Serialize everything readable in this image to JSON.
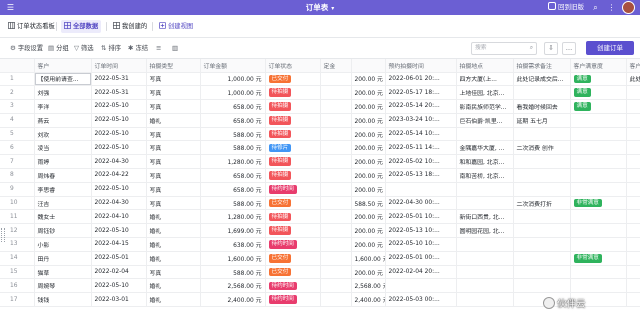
{
  "header": {
    "title": "订单表",
    "home_label": "回到旧版",
    "accent": "#6b5fd3"
  },
  "views": [
    {
      "label": "订单状态看板"
    },
    {
      "label": "全部数据"
    },
    {
      "label": "我创建的"
    },
    {
      "label": "创建视图"
    }
  ],
  "toolbar": {
    "field_settings": "字段设置",
    "group": "分组",
    "filter": "筛选",
    "sort": "排序",
    "freeze": "冻结",
    "search_placeholder": "搜索",
    "create_button": "创建订单"
  },
  "columns": [
    "",
    "客户",
    "订单时间",
    "拍摄类型",
    "订单金额",
    "订单状态",
    "定金",
    "",
    "预约拍摄时间",
    "拍摄地点",
    "拍摄需求备注",
    "客户满意度",
    "客户评价内容"
  ],
  "rows": [
    {
      "n": "1",
      "customer": "【使用前请查...",
      "date": "2022-05-31",
      "type": "写真",
      "amount": "1,000.00 元",
      "status": "已交付",
      "status_kind": "paid",
      "deposit": "",
      "balance": "200.00 元",
      "appt": "2022-06-01 20:...",
      "place": "四方大厦(上...",
      "note": "此处记录成交后...",
      "sat": "满意",
      "sat_kind": "sat",
      "review": "此处记录客户..."
    },
    {
      "n": "2",
      "customer": "刘强",
      "date": "2022-05-31",
      "type": "写真",
      "amount": "1,000.00 元",
      "status": "待拍摄",
      "status_kind": "pending",
      "deposit": "",
      "balance": "200.00 元",
      "appt": "2022-05-17 18:...",
      "place": "上地佳园, 北京...",
      "note": "",
      "sat": "满意",
      "sat_kind": "sat",
      "review": ""
    },
    {
      "n": "3",
      "customer": "李洋",
      "date": "2022-05-10",
      "type": "写真",
      "amount": "658.00 元",
      "status": "待拍摄",
      "status_kind": "pending",
      "deposit": "",
      "balance": "200.00 元",
      "appt": "2022-05-14 20:...",
      "place": "影南民族师范学...",
      "note": "看我婚时候回去",
      "sat": "满意",
      "sat_kind": "sat",
      "review": ""
    },
    {
      "n": "4",
      "customer": "燕云",
      "date": "2022-05-10",
      "type": "婚礼",
      "amount": "658.00 元",
      "status": "待拍摄",
      "status_kind": "pending",
      "deposit": "",
      "balance": "200.00 元",
      "appt": "2023-03-24 10:...",
      "place": "巨石伯爵·凯里...",
      "note": "延期 五七月",
      "sat": "",
      "sat_kind": "",
      "review": ""
    },
    {
      "n": "5",
      "customer": "刘欢",
      "date": "2022-05-10",
      "type": "写真",
      "amount": "588.00 元",
      "status": "待拍摄",
      "status_kind": "pending",
      "deposit": "",
      "balance": "200.00 元",
      "appt": "2022-05-14 10:...",
      "place": "",
      "note": "",
      "sat": "",
      "sat_kind": "",
      "review": ""
    },
    {
      "n": "6",
      "customer": "凌当",
      "date": "2022-05-10",
      "type": "写真",
      "amount": "588.00 元",
      "status": "待修片",
      "status_kind": "film",
      "deposit": "",
      "balance": "200.00 元",
      "appt": "2022-05-11 14:...",
      "place": "金隅嘉华大厦, ...",
      "note": "二次消费 创作",
      "sat": "",
      "sat_kind": "",
      "review": ""
    },
    {
      "n": "7",
      "customer": "雨婷",
      "date": "2022-04-30",
      "type": "写真",
      "amount": "1,280.00 元",
      "status": "待拍摄",
      "status_kind": "pending",
      "deposit": "",
      "balance": "200.00 元",
      "appt": "2022-05-02 10:...",
      "place": "和和嘉园, 北京...",
      "note": "",
      "sat": "",
      "sat_kind": "",
      "review": ""
    },
    {
      "n": "8",
      "customer": "周炜春",
      "date": "2022-04-22",
      "type": "写真",
      "amount": "658.00 元",
      "status": "待拍摄",
      "status_kind": "pending",
      "deposit": "",
      "balance": "200.00 元",
      "appt": "2022-05-13 18:...",
      "place": "南和苦桥, 北京...",
      "note": "",
      "sat": "",
      "sat_kind": "",
      "review": ""
    },
    {
      "n": "9",
      "customer": "李思睿",
      "date": "2022-05-10",
      "type": "写真",
      "amount": "658.00 元",
      "status": "待约时间",
      "status_kind": "wait",
      "deposit": "",
      "balance": "200.00 元",
      "appt": "",
      "place": "",
      "note": "",
      "sat": "",
      "sat_kind": "",
      "review": ""
    },
    {
      "n": "10",
      "customer": "汪吉",
      "date": "2022-04-30",
      "type": "写真",
      "amount": "588.00 元",
      "status": "已交付",
      "status_kind": "paid",
      "deposit": "",
      "balance": "588.50 元",
      "appt": "2022-04-30 00:...",
      "place": "",
      "note": "二次消费打折",
      "sat": "非常满意",
      "sat_kind": "vsat",
      "review": ""
    },
    {
      "n": "11",
      "customer": "魏女士",
      "date": "2022-04-10",
      "type": "婚礼",
      "amount": "1,280.00 元",
      "status": "待拍摄",
      "status_kind": "pending",
      "deposit": "",
      "balance": "200.00 元",
      "appt": "2022-05-01 10:...",
      "place": "新街口西贯, 北...",
      "note": "",
      "sat": "",
      "sat_kind": "",
      "review": ""
    },
    {
      "n": "12",
      "customer": "周钰钞",
      "date": "2022-05-10",
      "type": "婚礼",
      "amount": "1,699.00 元",
      "status": "待拍摄",
      "status_kind": "pending",
      "deposit": "",
      "balance": "200.00 元",
      "appt": "2022-05-13 10:...",
      "place": "圆明园花园, 北...",
      "note": "",
      "sat": "",
      "sat_kind": "",
      "review": ""
    },
    {
      "n": "13",
      "customer": "小影",
      "date": "2022-04-15",
      "type": "婚礼",
      "amount": "638.00 元",
      "status": "待约时间",
      "status_kind": "wait",
      "deposit": "",
      "balance": "200.00 元",
      "appt": "2022-05-10 10:...",
      "place": "",
      "note": "",
      "sat": "",
      "sat_kind": "",
      "review": ""
    },
    {
      "n": "14",
      "customer": "田丹",
      "date": "2022-05-01",
      "type": "婚礼",
      "amount": "1,600.00 元",
      "status": "已交付",
      "status_kind": "paid",
      "deposit": "",
      "balance": "1,600.00 元",
      "appt": "2022-05-01 00:...",
      "place": "",
      "note": "",
      "sat": "非常满意",
      "sat_kind": "vsat",
      "review": ""
    },
    {
      "n": "15",
      "customer": "猫草",
      "date": "2022-02-04",
      "type": "写真",
      "amount": "588.00 元",
      "status": "已交付",
      "status_kind": "paid",
      "deposit": "",
      "balance": "200.00 元",
      "appt": "2022-02-04 20:...",
      "place": "",
      "note": "",
      "sat": "",
      "sat_kind": "",
      "review": ""
    },
    {
      "n": "16",
      "customer": "周婉琴",
      "date": "2022-05-10",
      "type": "婚礼",
      "amount": "2,568.00 元",
      "status": "待约时间",
      "status_kind": "wait",
      "deposit": "",
      "balance": "2,568.00 元",
      "appt": "",
      "place": "",
      "note": "",
      "sat": "",
      "sat_kind": "",
      "review": ""
    },
    {
      "n": "17",
      "customer": "钱钱",
      "date": "2022-03-01",
      "type": "婚礼",
      "amount": "2,400.00 元",
      "status": "待约时间",
      "status_kind": "wait",
      "deposit": "",
      "balance": "2,400.00 元",
      "appt": "2022-05-03 00:...",
      "place": "",
      "note": "",
      "sat": "",
      "sat_kind": "",
      "review": ""
    }
  ],
  "watermark": "伙伴云"
}
